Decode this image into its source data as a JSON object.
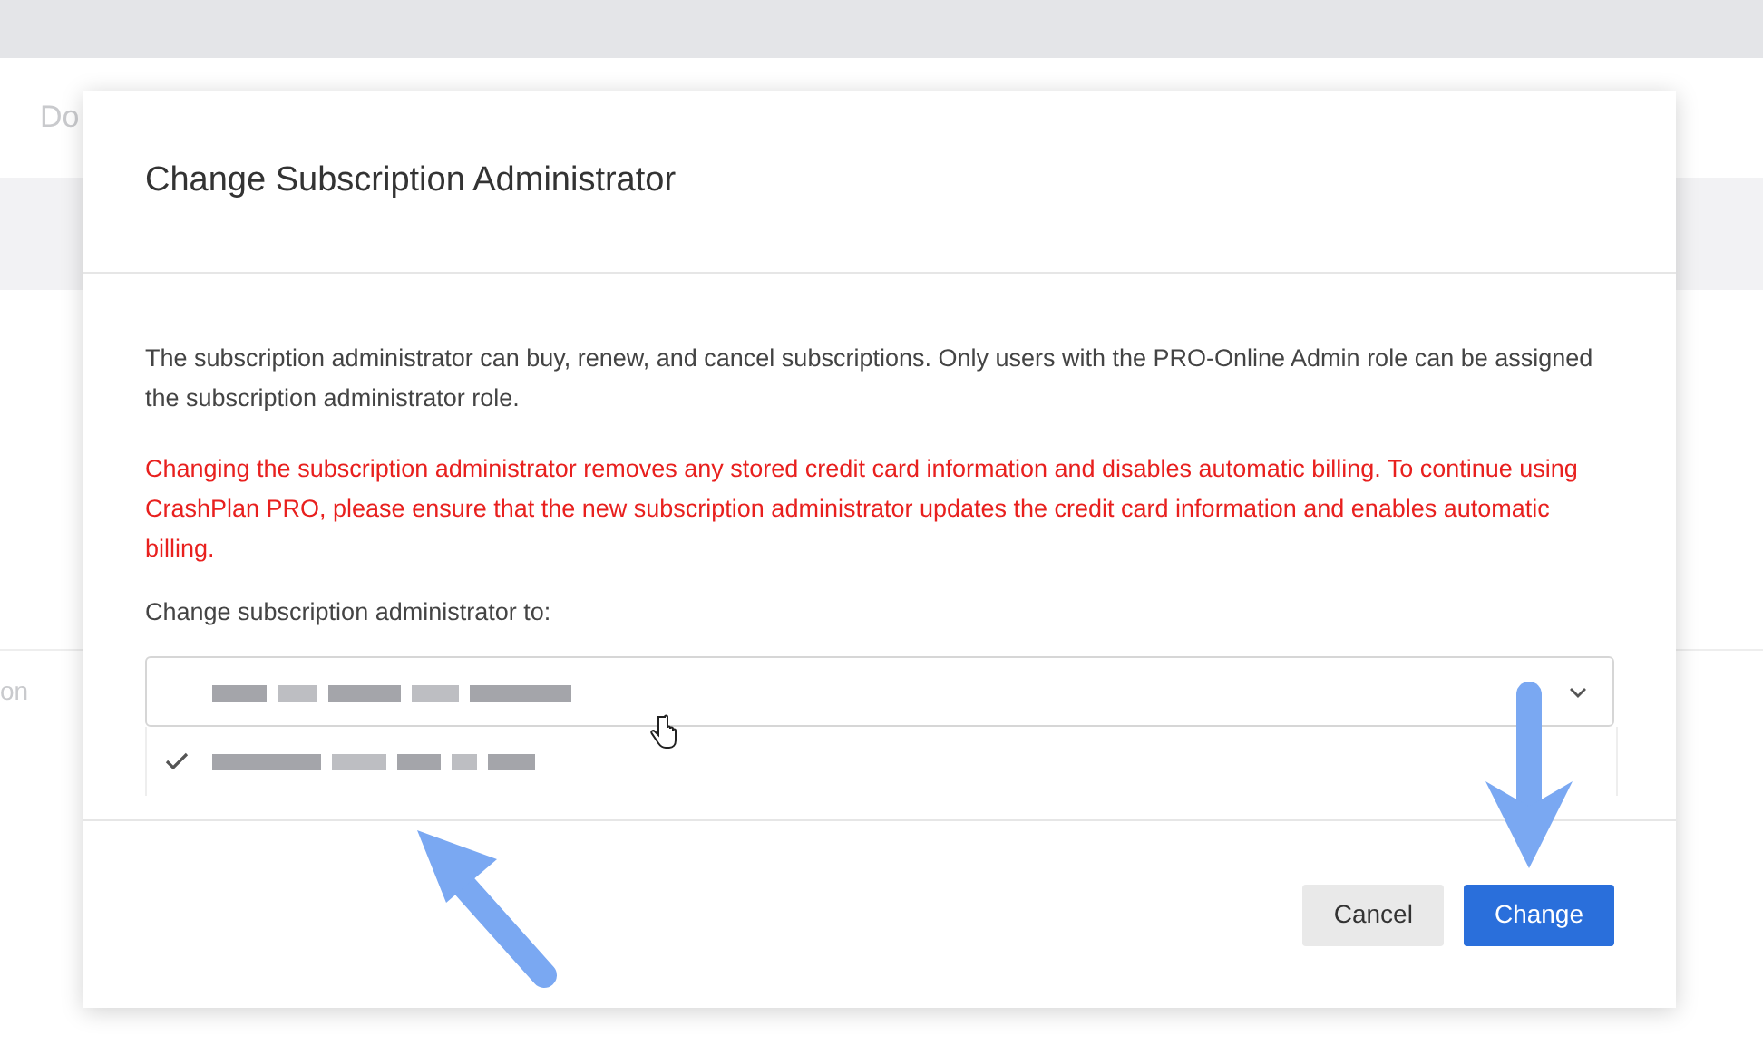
{
  "background_page": {
    "header_text": "Do",
    "side_text": "on"
  },
  "dialog": {
    "title": "Change Subscription Administrator",
    "description": "The subscription administrator can buy, renew, and cancel subscriptions. Only users with the PRO-Online Admin role can be assigned the subscription administrator role.",
    "warning": "Changing the subscription administrator removes any stored credit card information and disables automatic billing. To continue using CrashPlan PRO, please ensure that the new subscription administrator updates the credit card information and enables automatic billing.",
    "field_label": "Change subscription administrator to:",
    "dropdown_options": [
      {
        "selected": true
      }
    ],
    "buttons": [
      {
        "label": "Cancel",
        "kind": "secondary"
      },
      {
        "label": "Change",
        "kind": "primary"
      }
    ]
  }
}
